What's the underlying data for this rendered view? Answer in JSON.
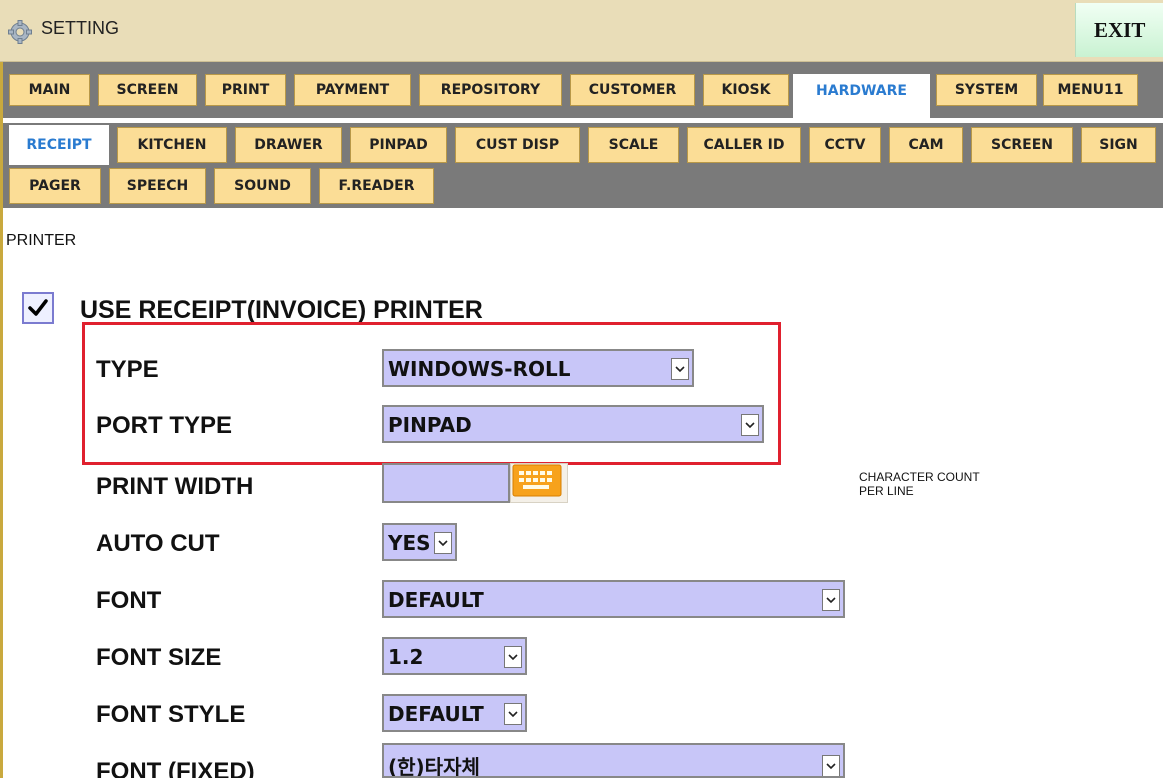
{
  "window": {
    "title": "SETTING",
    "exit_label": "EXIT"
  },
  "main_tabs": [
    {
      "label": "MAIN"
    },
    {
      "label": "SCREEN"
    },
    {
      "label": "PRINT"
    },
    {
      "label": "PAYMENT"
    },
    {
      "label": "REPOSITORY"
    },
    {
      "label": "CUSTOMER"
    },
    {
      "label": "KIOSK"
    },
    {
      "label": "HARDWARE"
    },
    {
      "label": "SYSTEM"
    },
    {
      "label": "MENU11"
    }
  ],
  "active_main_tab": "HARDWARE",
  "sub_tabs": [
    {
      "label": "RECEIPT"
    },
    {
      "label": "KITCHEN"
    },
    {
      "label": "DRAWER"
    },
    {
      "label": "PINPAD"
    },
    {
      "label": "CUST DISP"
    },
    {
      "label": "SCALE"
    },
    {
      "label": "CALLER ID"
    },
    {
      "label": "CCTV"
    },
    {
      "label": "CAM"
    },
    {
      "label": "SCREEN"
    },
    {
      "label": "SIGN"
    },
    {
      "label": "PAGER"
    },
    {
      "label": "SPEECH"
    },
    {
      "label": "SOUND"
    },
    {
      "label": "F.READER"
    }
  ],
  "active_sub_tab": "RECEIPT",
  "section": {
    "title": "PRINTER",
    "use_printer": {
      "label": "USE RECEIPT(INVOICE) PRINTER",
      "checked": true
    }
  },
  "fields": {
    "type": {
      "label": "TYPE",
      "value": "WINDOWS-ROLL"
    },
    "port_type": {
      "label": "PORT TYPE",
      "value": "PINPAD"
    },
    "print_width": {
      "label": "PRINT WIDTH",
      "value": "",
      "hint_line1": "CHARACTER COUNT",
      "hint_line2": "PER LINE"
    },
    "auto_cut": {
      "label": "AUTO CUT",
      "value": "YES"
    },
    "font": {
      "label": "FONT",
      "value": "DEFAULT"
    },
    "font_size": {
      "label": "FONT SIZE",
      "value": "1.2"
    },
    "font_style": {
      "label": "FONT STYLE",
      "value": "DEFAULT"
    },
    "font_fixed": {
      "label": "FONT (FIXED)",
      "value": "(한)타자체"
    }
  },
  "colors": {
    "tab_bg": "#fbdd96",
    "active_tab_text": "#2a7bd0",
    "tab_strip": "#7a7a7a",
    "select_bg": "#c8c6f8",
    "highlight": "#e0202e",
    "titlebar": "#e9ddb8"
  },
  "icons": {
    "title": "gear-icon",
    "checkbox": "checkmark-icon",
    "keyboard": "keyboard-icon",
    "dropdown": "chevron-down-icon"
  }
}
